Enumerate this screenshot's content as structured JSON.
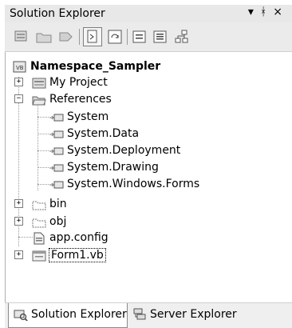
{
  "window": {
    "title": "Solution Explorer",
    "controls": [
      "▾",
      "ᚼ",
      "×"
    ]
  },
  "toolbar": {
    "buttons": [
      {
        "name": "properties-button",
        "icon": "properties-icon"
      },
      {
        "name": "show-all-files-button",
        "icon": "folder-icon"
      },
      {
        "name": "refresh-button",
        "icon": "refresh-icon"
      },
      {
        "name": "view-code-button",
        "icon": "code-icon",
        "pressed": true
      },
      {
        "name": "view-designer-button",
        "icon": "designer-icon"
      },
      {
        "name": "class-diagram-button",
        "icon": "class-diagram-icon"
      }
    ]
  },
  "tree": {
    "solution": "Namespace_Sampler",
    "items": [
      {
        "label": "My Project",
        "icon": "my-project-icon",
        "expander": "+"
      },
      {
        "label": "References",
        "icon": "open-folder-icon",
        "expander": "−"
      },
      {
        "label": "System",
        "icon": "reference-icon"
      },
      {
        "label": "System.Data",
        "icon": "reference-icon"
      },
      {
        "label": "System.Deployment",
        "icon": "reference-icon"
      },
      {
        "label": "System.Drawing",
        "icon": "reference-icon"
      },
      {
        "label": "System.Windows.Forms",
        "icon": "reference-icon"
      },
      {
        "label": "bin",
        "icon": "folder-icon",
        "expander": "+"
      },
      {
        "label": "obj",
        "icon": "folder-icon",
        "expander": "+"
      },
      {
        "label": "app.config",
        "icon": "config-file-icon"
      },
      {
        "label": "Form1.vb",
        "icon": "form-icon",
        "expander": "+",
        "selected": true
      }
    ]
  },
  "tabs": [
    {
      "label": "Solution Explorer",
      "icon": "solution-explorer-icon",
      "active": true
    },
    {
      "label": "Server Explorer",
      "icon": "server-explorer-icon",
      "active": false
    }
  ]
}
